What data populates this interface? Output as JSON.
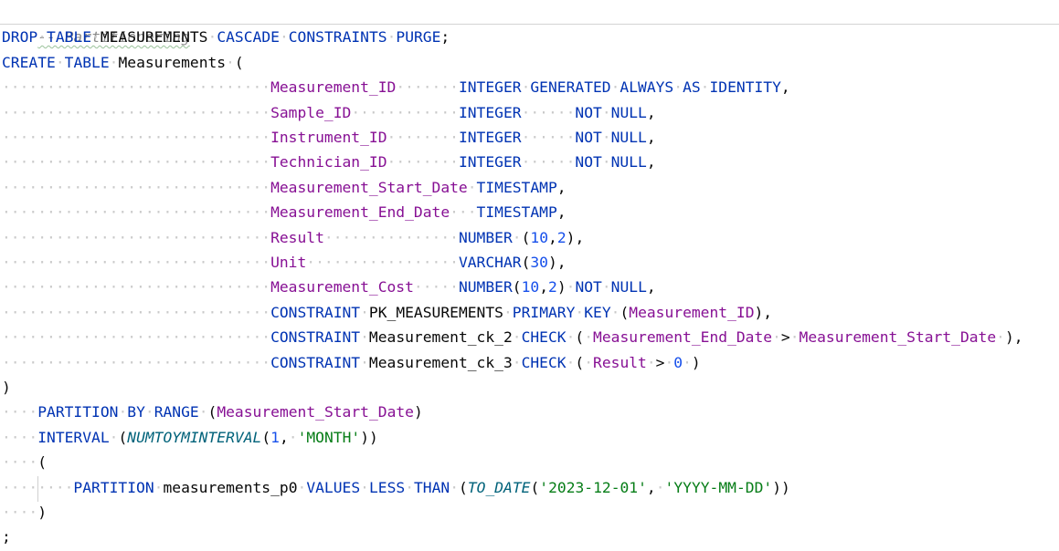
{
  "editor": {
    "comment": "-- Partitionering",
    "lines": [
      [
        [
          "kw",
          "DROP"
        ],
        [
          "ws",
          "·"
        ],
        [
          "kw",
          "TABLE"
        ],
        [
          "ws",
          "·"
        ],
        [
          "tx",
          "MEASUREMENTS"
        ],
        [
          "ws",
          "·"
        ],
        [
          "kw",
          "CASCADE"
        ],
        [
          "ws",
          "·"
        ],
        [
          "kw",
          "CONSTRAINTS"
        ],
        [
          "ws",
          "·"
        ],
        [
          "kw",
          "PURGE"
        ],
        [
          "tx",
          ";"
        ]
      ],
      [
        [
          "kw",
          "CREATE"
        ],
        [
          "ws",
          "·"
        ],
        [
          "kw",
          "TABLE"
        ],
        [
          "ws",
          "·"
        ],
        [
          "tx",
          "Measurements"
        ],
        [
          "ws",
          "·"
        ],
        [
          "tx",
          "("
        ]
      ],
      [
        [
          "ws",
          "······························"
        ],
        [
          "col",
          "Measurement_ID"
        ],
        [
          "ws",
          "·······"
        ],
        [
          "kw",
          "INTEGER"
        ],
        [
          "ws",
          "·"
        ],
        [
          "kw",
          "GENERATED"
        ],
        [
          "ws",
          "·"
        ],
        [
          "kw",
          "ALWAYS"
        ],
        [
          "ws",
          "·"
        ],
        [
          "kw",
          "AS"
        ],
        [
          "ws",
          "·"
        ],
        [
          "kw",
          "IDENTITY"
        ],
        [
          "tx",
          ","
        ]
      ],
      [
        [
          "ws",
          "······························"
        ],
        [
          "col",
          "Sample_ID"
        ],
        [
          "ws",
          "············"
        ],
        [
          "kw",
          "INTEGER"
        ],
        [
          "ws",
          "······"
        ],
        [
          "kw",
          "NOT"
        ],
        [
          "ws",
          "·"
        ],
        [
          "kw",
          "NULL"
        ],
        [
          "tx",
          ","
        ]
      ],
      [
        [
          "ws",
          "······························"
        ],
        [
          "col",
          "Instrument_ID"
        ],
        [
          "ws",
          "········"
        ],
        [
          "kw",
          "INTEGER"
        ],
        [
          "ws",
          "······"
        ],
        [
          "kw",
          "NOT"
        ],
        [
          "ws",
          "·"
        ],
        [
          "kw",
          "NULL"
        ],
        [
          "tx",
          ","
        ]
      ],
      [
        [
          "ws",
          "······························"
        ],
        [
          "col",
          "Technician_ID"
        ],
        [
          "ws",
          "········"
        ],
        [
          "kw",
          "INTEGER"
        ],
        [
          "ws",
          "······"
        ],
        [
          "kw",
          "NOT"
        ],
        [
          "ws",
          "·"
        ],
        [
          "kw",
          "NULL"
        ],
        [
          "tx",
          ","
        ]
      ],
      [
        [
          "ws",
          "······························"
        ],
        [
          "col",
          "Measurement_Start_Date"
        ],
        [
          "ws",
          "·"
        ],
        [
          "kw",
          "TIMESTAMP"
        ],
        [
          "tx",
          ","
        ]
      ],
      [
        [
          "ws",
          "······························"
        ],
        [
          "col",
          "Measurement_End_Date"
        ],
        [
          "ws",
          "···"
        ],
        [
          "kw",
          "TIMESTAMP"
        ],
        [
          "tx",
          ","
        ]
      ],
      [
        [
          "ws",
          "······························"
        ],
        [
          "col",
          "Result"
        ],
        [
          "ws",
          "···············"
        ],
        [
          "kw",
          "NUMBER"
        ],
        [
          "ws",
          "·"
        ],
        [
          "tx",
          "("
        ],
        [
          "num",
          "10"
        ],
        [
          "tx",
          ","
        ],
        [
          "num",
          "2"
        ],
        [
          "tx",
          "),"
        ]
      ],
      [
        [
          "ws",
          "······························"
        ],
        [
          "col",
          "Unit"
        ],
        [
          "ws",
          "·················"
        ],
        [
          "kw",
          "VARCHAR"
        ],
        [
          "tx",
          "("
        ],
        [
          "num",
          "30"
        ],
        [
          "tx",
          "),"
        ]
      ],
      [
        [
          "ws",
          "······························"
        ],
        [
          "col",
          "Measurement_Cost"
        ],
        [
          "ws",
          "·····"
        ],
        [
          "kw",
          "NUMBER"
        ],
        [
          "tx",
          "("
        ],
        [
          "num",
          "10"
        ],
        [
          "tx",
          ","
        ],
        [
          "num",
          "2"
        ],
        [
          "tx",
          ")"
        ],
        [
          "ws",
          "·"
        ],
        [
          "kw",
          "NOT"
        ],
        [
          "ws",
          "·"
        ],
        [
          "kw",
          "NULL"
        ],
        [
          "tx",
          ","
        ]
      ],
      [
        [
          "ws",
          "······························"
        ],
        [
          "kw",
          "CONSTRAINT"
        ],
        [
          "ws",
          "·"
        ],
        [
          "tx",
          "PK_MEASUREMENTS"
        ],
        [
          "ws",
          "·"
        ],
        [
          "kw",
          "PRIMARY"
        ],
        [
          "ws",
          "·"
        ],
        [
          "kw",
          "KEY"
        ],
        [
          "ws",
          "·"
        ],
        [
          "tx",
          "("
        ],
        [
          "col",
          "Measurement_ID"
        ],
        [
          "tx",
          "),"
        ]
      ],
      [
        [
          "ws",
          "······························"
        ],
        [
          "kw",
          "CONSTRAINT"
        ],
        [
          "ws",
          "·"
        ],
        [
          "tx",
          "Measurement_ck_2"
        ],
        [
          "ws",
          "·"
        ],
        [
          "kw",
          "CHECK"
        ],
        [
          "ws",
          "·"
        ],
        [
          "tx",
          "("
        ],
        [
          "ws",
          "·"
        ],
        [
          "col",
          "Measurement_End_Date"
        ],
        [
          "ws",
          "·"
        ],
        [
          "tx",
          ">"
        ],
        [
          "ws",
          "·"
        ],
        [
          "col",
          "Measurement_Start_Date"
        ],
        [
          "ws",
          "·"
        ],
        [
          "tx",
          "),"
        ]
      ],
      [
        [
          "ws",
          "······························"
        ],
        [
          "kw",
          "CONSTRAINT"
        ],
        [
          "ws",
          "·"
        ],
        [
          "tx",
          "Measurement_ck_3"
        ],
        [
          "ws",
          "·"
        ],
        [
          "kw",
          "CHECK"
        ],
        [
          "ws",
          "·"
        ],
        [
          "tx",
          "("
        ],
        [
          "ws",
          "·"
        ],
        [
          "col",
          "Result"
        ],
        [
          "ws",
          "·"
        ],
        [
          "tx",
          ">"
        ],
        [
          "ws",
          "·"
        ],
        [
          "num",
          "0"
        ],
        [
          "ws",
          "·"
        ],
        [
          "tx",
          ")"
        ]
      ],
      [
        [
          "tx",
          ")"
        ]
      ],
      [
        [
          "ws",
          "····"
        ],
        [
          "kw",
          "PARTITION"
        ],
        [
          "ws",
          "·"
        ],
        [
          "kw",
          "BY"
        ],
        [
          "ws",
          "·"
        ],
        [
          "kw",
          "RANGE"
        ],
        [
          "ws",
          "·"
        ],
        [
          "tx",
          "("
        ],
        [
          "col",
          "Measurement_Start_Date"
        ],
        [
          "tx",
          ")"
        ]
      ],
      [
        [
          "ws",
          "····"
        ],
        [
          "kw",
          "INTERVAL"
        ],
        [
          "ws",
          "·"
        ],
        [
          "tx",
          "("
        ],
        [
          "fn",
          "NUMTOYMINTERVAL"
        ],
        [
          "tx",
          "("
        ],
        [
          "num",
          "1"
        ],
        [
          "tx",
          ","
        ],
        [
          "ws",
          "·"
        ],
        [
          "str",
          "'MONTH'"
        ],
        [
          "tx",
          "))"
        ]
      ],
      [
        [
          "ws",
          "····"
        ],
        [
          "tx",
          "("
        ]
      ],
      [
        [
          "ws",
          "········"
        ],
        [
          "kw",
          "PARTITION"
        ],
        [
          "ws",
          "·"
        ],
        [
          "tx",
          "measurements_p0"
        ],
        [
          "ws",
          "·"
        ],
        [
          "kw",
          "VALUES"
        ],
        [
          "ws",
          "·"
        ],
        [
          "kw",
          "LESS"
        ],
        [
          "ws",
          "·"
        ],
        [
          "kw",
          "THAN"
        ],
        [
          "ws",
          "·"
        ],
        [
          "tx",
          "("
        ],
        [
          "fn",
          "TO_DATE"
        ],
        [
          "tx",
          "("
        ],
        [
          "str",
          "'2023-12-01'"
        ],
        [
          "tx",
          ","
        ],
        [
          "ws",
          "·"
        ],
        [
          "str",
          "'YYYY-MM-DD'"
        ],
        [
          "tx",
          "))"
        ]
      ],
      [
        [
          "ws",
          "····"
        ],
        [
          "tx",
          ")"
        ]
      ],
      [
        [
          "tx",
          ";"
        ]
      ]
    ]
  }
}
